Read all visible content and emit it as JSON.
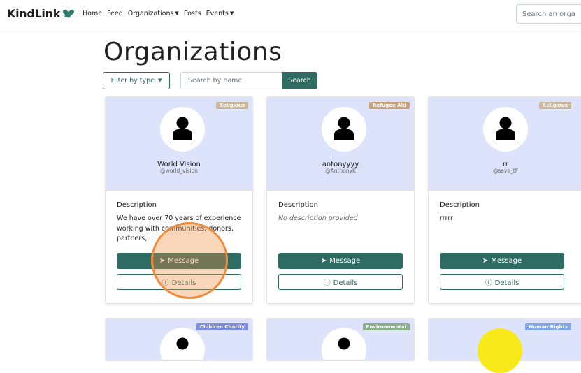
{
  "nav": {
    "brand": "KindLink",
    "links": [
      "Home",
      "Feed",
      "Organizations",
      "Posts",
      "Events"
    ],
    "search_placeholder": "Search an orga"
  },
  "page": {
    "title": "Organizations",
    "filter_label": "Filter by type",
    "search_placeholder": "Search by name",
    "search_button": "Search"
  },
  "cards": [
    {
      "badge": "Religious",
      "badge_color": "#c9b79a",
      "name": "World Vision",
      "handle": "@world_vision",
      "description_label": "Description",
      "description": "We have over 70 years of experience working with communities, donors, partners,...",
      "message_label": "Message",
      "details_label": "Details"
    },
    {
      "badge": "Refugee Aid",
      "badge_color": "#c9a27a",
      "name": "antonyyyy",
      "handle": "@AnthonyK",
      "description_label": "Description",
      "description": "No description provided",
      "message_label": "Message",
      "details_label": "Details"
    },
    {
      "badge": "Religious",
      "badge_color": "#c9b79a",
      "name": "rr",
      "handle": "@save_tF",
      "description_label": "Description",
      "description": "rrrrr",
      "message_label": "Message",
      "details_label": "Details"
    }
  ],
  "next_row_badges": [
    {
      "label": "Children Charity",
      "color": "#7b8ce0"
    },
    {
      "label": "Environmental",
      "color": "#8ab08a"
    },
    {
      "label": "Human Rights",
      "color": "#7fa6e8"
    }
  ],
  "colors": {
    "accent": "#2e6b63",
    "card_header": "#dde3fb"
  }
}
